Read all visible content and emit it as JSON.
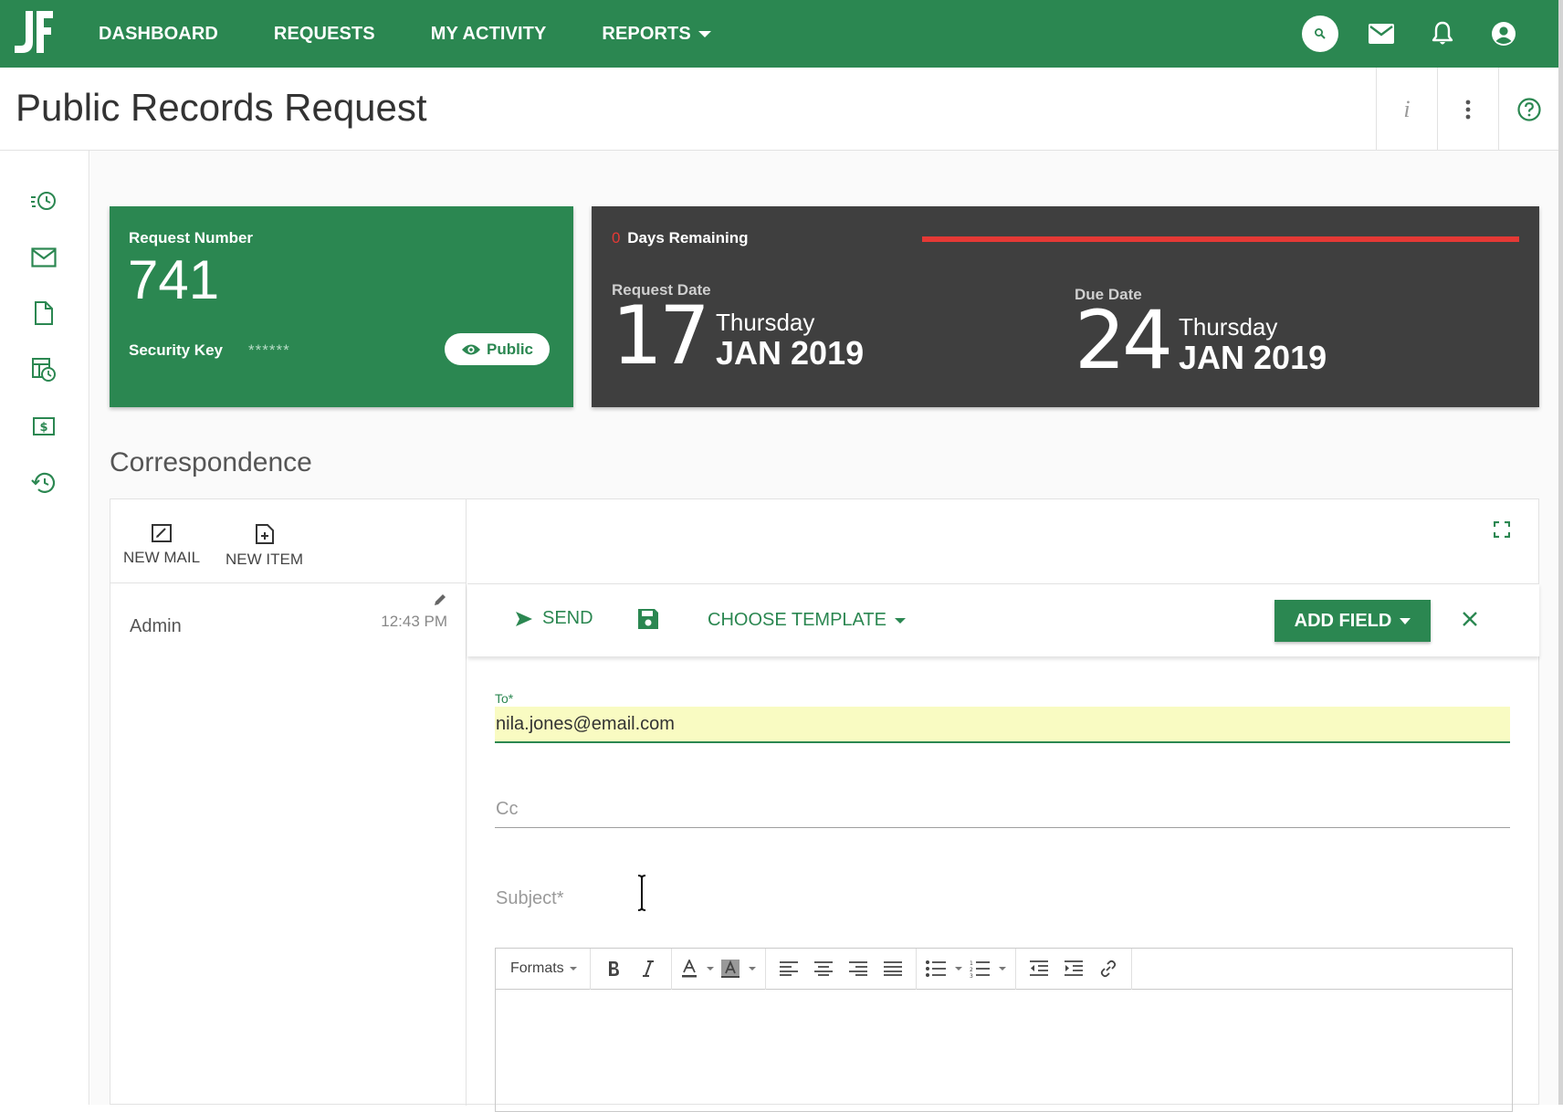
{
  "nav": {
    "items": [
      {
        "label": "DASHBOARD"
      },
      {
        "label": "REQUESTS"
      },
      {
        "label": "MY ACTIVITY"
      },
      {
        "label": "REPORTS"
      }
    ]
  },
  "title": {
    "text": "Public Records Request",
    "info_glyph": "i"
  },
  "request_card": {
    "number_label": "Request Number",
    "number": "741",
    "security_key_label": "Security Key",
    "security_key_value": "******",
    "visibility": "Public"
  },
  "dates_card": {
    "days_remaining": "0",
    "days_remaining_label": "Days Remaining",
    "request_date": {
      "label": "Request Date",
      "day": "17",
      "weekday": "Thursday",
      "month_year": "JAN 2019"
    },
    "due_date": {
      "label": "Due Date",
      "day": "24",
      "weekday": "Thursday",
      "month_year": "JAN 2019"
    },
    "progress_fraction": 1.0
  },
  "correspondence": {
    "section_title": "Correspondence",
    "tools": [
      {
        "label": "NEW MAIL"
      },
      {
        "label": "NEW ITEM"
      }
    ],
    "messages": [
      {
        "from": "Admin",
        "time": "12:43 PM"
      }
    ],
    "compose": {
      "send_label": "SEND",
      "template_label": "CHOOSE TEMPLATE",
      "add_field_label": "ADD FIELD",
      "to_label": "To*",
      "to_value": "nila.jones@email.com",
      "cc_placeholder": "Cc",
      "subject_placeholder": "Subject*"
    },
    "editor": {
      "formats_label": "Formats"
    }
  },
  "colors": {
    "brand_green": "#2b8751",
    "dark_card": "#3f3f3f",
    "alert_red": "#e53935",
    "highlight_yellow": "#f9fbc2"
  },
  "icons": [
    "logo-icon",
    "search-icon",
    "mail-icon",
    "bell-icon",
    "account-icon",
    "info-icon",
    "more-vert-icon",
    "help-icon",
    "history-list-icon",
    "mail-icon",
    "document-icon",
    "table-clock-icon",
    "dollar-icon",
    "restore-icon",
    "eye-icon",
    "edit-square-icon",
    "add-item-icon",
    "pencil-icon",
    "fullscreen-icon",
    "send-icon",
    "save-icon",
    "close-icon",
    "bold-icon",
    "italic-icon",
    "font-color-icon",
    "bg-color-icon",
    "align-left-icon",
    "align-center-icon",
    "align-right-icon",
    "align-justify-icon",
    "bullet-list-icon",
    "numbered-list-icon",
    "outdent-icon",
    "indent-icon",
    "link-icon"
  ]
}
